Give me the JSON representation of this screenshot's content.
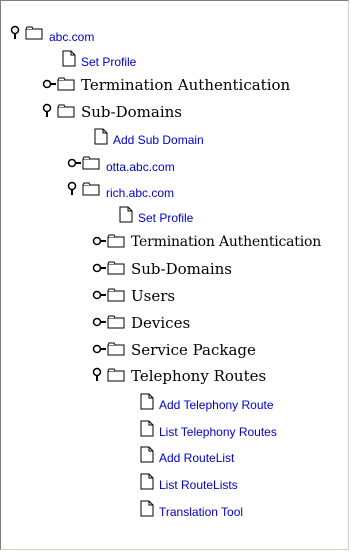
{
  "tree": {
    "root": {
      "label": "abc.com",
      "icon": "pin-icon"
    },
    "root_set_profile": {
      "label": "Set Profile"
    },
    "termination_auth": {
      "label": "Termination Authentication",
      "icon": "eye-icon"
    },
    "sub_domains": {
      "label": "Sub-Domains",
      "icon": "pin-icon"
    },
    "add_sub_domain": {
      "label": "Add Sub Domain"
    },
    "otta": {
      "label": "otta.abc.com",
      "icon": "eye-icon"
    },
    "rich": {
      "label": "rich.abc.com",
      "icon": "pin-icon"
    },
    "rich_set_profile": {
      "label": "Set Profile"
    },
    "rich_termination_auth": {
      "label": "Termination Authentication",
      "icon": "eye-icon"
    },
    "rich_sub_domains": {
      "label": "Sub-Domains",
      "icon": "eye-icon"
    },
    "rich_users": {
      "label": "Users",
      "icon": "eye-icon"
    },
    "rich_devices": {
      "label": "Devices",
      "icon": "eye-icon"
    },
    "rich_service_package": {
      "label": "Service Package",
      "icon": "eye-icon"
    },
    "rich_telephony_routes": {
      "label": "Telephony Routes",
      "icon": "pin-icon"
    },
    "add_telephony_route": {
      "label": "Add Telephony Route"
    },
    "list_telephony_routes": {
      "label": "List Telephony Routes"
    },
    "add_routelist": {
      "label": "Add RouteList"
    },
    "list_routelists": {
      "label": "List RouteLists"
    },
    "translation_tool": {
      "label": "Translation Tool"
    }
  },
  "colors": {
    "link": "#0000cc",
    "text": "#000000",
    "folder_fill": "#ffffff",
    "folder_stroke": "#000000"
  }
}
